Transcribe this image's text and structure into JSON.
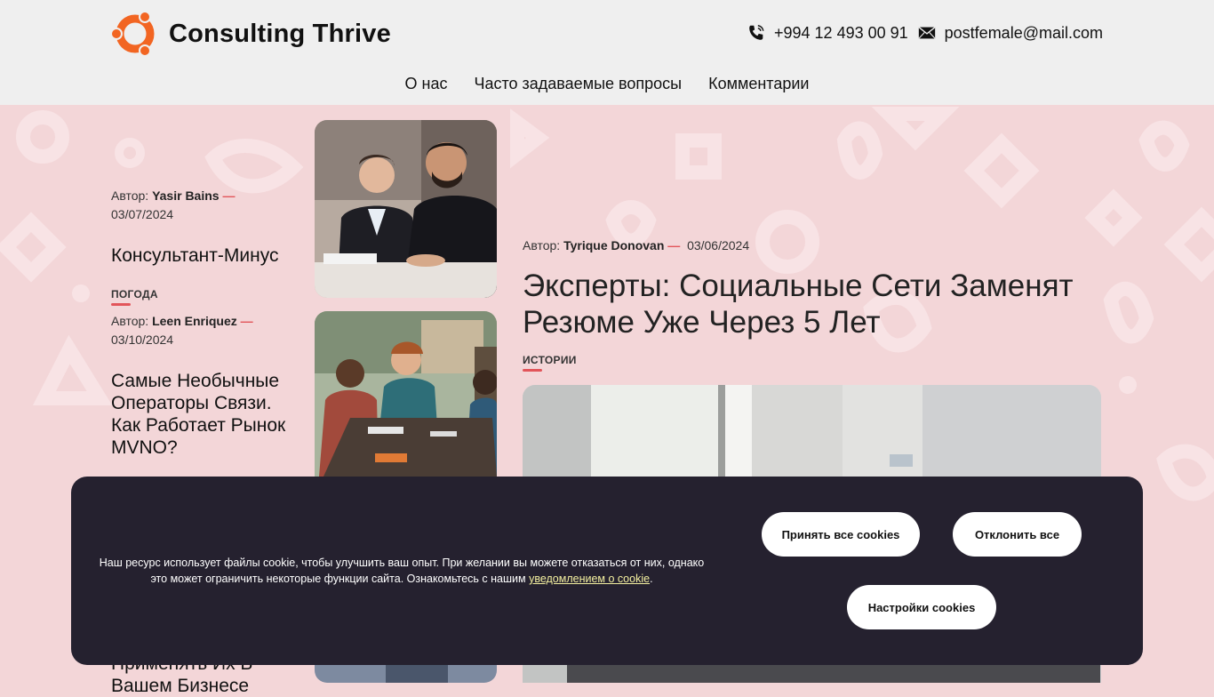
{
  "header": {
    "brand": "Consulting Thrive",
    "phone": "+994 12 493 00 91",
    "email": "postfemale@mail.com"
  },
  "nav": {
    "items": [
      {
        "label": "О нас"
      },
      {
        "label": "Часто задаваемые вопросы"
      },
      {
        "label": "Комментарии"
      }
    ]
  },
  "left_posts": [
    {
      "author_prefix": "Автор:",
      "author": "Yasir Bains",
      "date": "03/07/2024",
      "title": "Консультант-Минус",
      "tag": "ПОГОДА"
    },
    {
      "author_prefix": "Автор:",
      "author": "Leen Enriquez",
      "date": "03/10/2024",
      "title": "Самые Необычные Операторы Связи. Как Работает Рынок MVNO?"
    },
    {
      "title_partial": "Применять Их В Вашем Бизнесе"
    }
  ],
  "featured": {
    "author_prefix": "Автор:",
    "author": "Tyrique Donovan",
    "date": "03/06/2024",
    "title": "Эксперты: Социальные Сети Заменят Резюме Уже Через 5 Лет",
    "tag": "ИСТОРИИ"
  },
  "cookie": {
    "text_before": "Наш ресурс использует файлы cookie, чтобы улучшить ваш опыт. При желании вы можете отказаться от них, однако это может ограничить некоторые функции сайта. Ознакомьтесь с нашим ",
    "link_text": "уведомлением о cookie",
    "text_after": ".",
    "accept_label": "Принять все cookies",
    "reject_label": "Отклонить все",
    "settings_label": "Настройки cookies"
  },
  "colors": {
    "accent": "#e2555a",
    "logo": "#f26522",
    "banner_bg": "#25212f",
    "page_bg": "#f3d6d8",
    "header_bg": "#efefef"
  }
}
